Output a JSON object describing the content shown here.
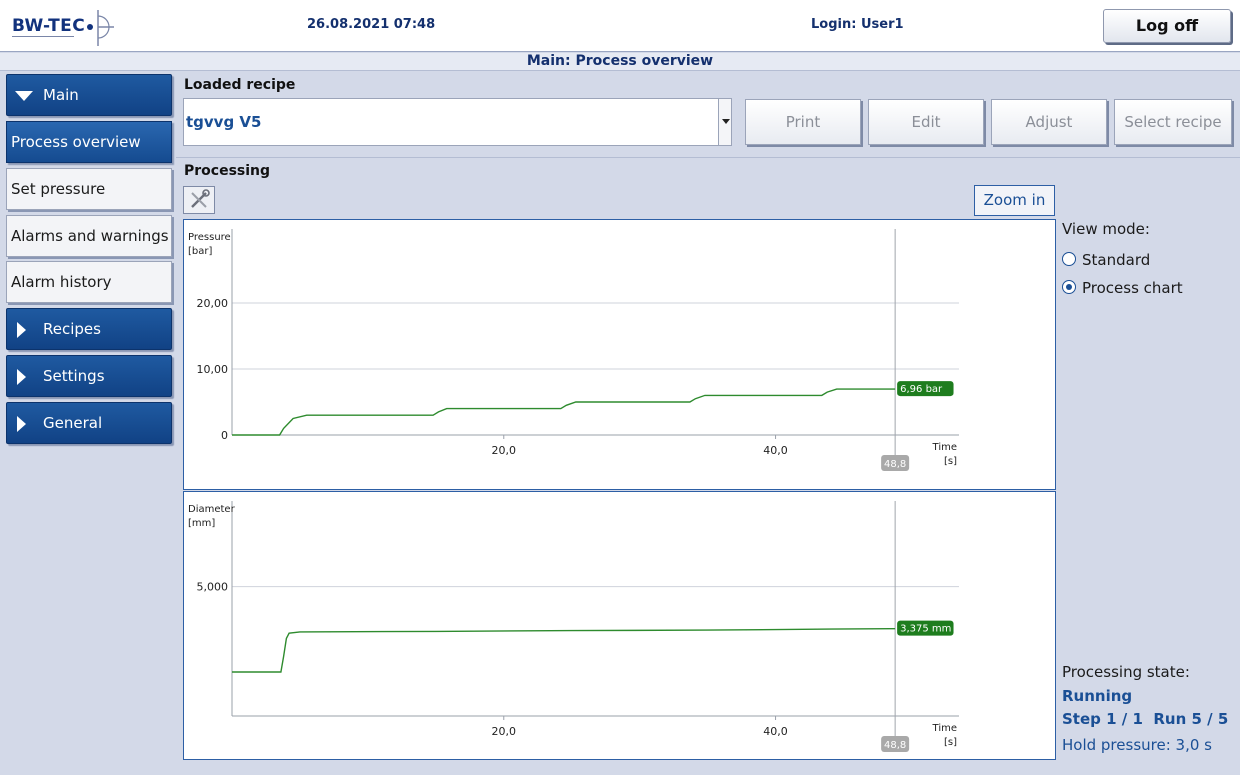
{
  "header": {
    "logo_text": "BW-TEC",
    "datetime": "26.08.2021 07:48",
    "login": "Login: User1",
    "logoff_label": "Log off",
    "page_title": "Main: Process overview"
  },
  "sidebar": {
    "items": [
      {
        "label": "Main",
        "kind": "group-expanded"
      },
      {
        "label": "Process overview",
        "kind": "active"
      },
      {
        "label": "Set pressure",
        "kind": "item"
      },
      {
        "label": "Alarms and warnings",
        "kind": "item"
      },
      {
        "label": "Alarm history",
        "kind": "item"
      },
      {
        "label": "Recipes",
        "kind": "group-collapsed"
      },
      {
        "label": "Settings",
        "kind": "group-collapsed"
      },
      {
        "label": "General",
        "kind": "group-collapsed"
      }
    ]
  },
  "recipe": {
    "section_label": "Loaded recipe",
    "value": "tgvvg V5",
    "buttons": {
      "print": "Print",
      "edit": "Edit",
      "adjust": "Adjust",
      "select": "Select recipe"
    }
  },
  "processing": {
    "section_label": "Processing",
    "zoom_label": "Zoom in",
    "tool_icon": "tools-icon"
  },
  "view_mode": {
    "label": "View mode:",
    "options": [
      "Standard",
      "Process chart"
    ],
    "selected": "Process chart"
  },
  "state": {
    "label": "Processing state:",
    "status": "Running",
    "step_run": "Step 1 / 1  Run 5 / 5",
    "hold": "Hold pressure: 3,0 s"
  },
  "colors": {
    "accent": "#1a4f95",
    "series": "#2e8b2e",
    "marker_badge": "#a9a9a9"
  },
  "chart_data": [
    {
      "type": "line",
      "ylabel": "Pressure",
      "yunit": "[bar]",
      "xlabel": "Time",
      "xunit": "[s]",
      "xlim": [
        0,
        53.5
      ],
      "ylim": [
        0,
        30
      ],
      "x_ticks": [
        "20,0",
        "40,0"
      ],
      "x_tick_values": [
        20,
        40
      ],
      "y_ticks": [
        "0",
        "10,00",
        "20,00"
      ],
      "y_tick_values": [
        0,
        10,
        20
      ],
      "cursor_x": 48.8,
      "cursor_label": "48,8",
      "value_label": "6,96 bar",
      "series": [
        {
          "x": [
            0,
            3.5,
            3.8,
            4.5,
            5.5,
            14.8,
            15.2,
            15.8,
            24.2,
            24.6,
            25.3,
            33.7,
            34.1,
            34.8,
            43.4,
            43.8,
            44.5,
            48.8
          ],
          "y": [
            0,
            0,
            1,
            2.5,
            3,
            3,
            3.5,
            4,
            4,
            4.5,
            5,
            5,
            5.5,
            6,
            6,
            6.5,
            6.96,
            6.96
          ]
        }
      ]
    },
    {
      "type": "line",
      "ylabel": "Diameter",
      "yunit": "[mm]",
      "xlabel": "Time",
      "xunit": "[s]",
      "xlim": [
        0,
        53.5
      ],
      "ylim": [
        0,
        8
      ],
      "x_ticks": [
        "20,0",
        "40,0"
      ],
      "x_tick_values": [
        20,
        40
      ],
      "y_ticks": [
        "5,000"
      ],
      "y_tick_values": [
        5
      ],
      "cursor_x": 48.8,
      "cursor_label": "48,8",
      "value_label": "3,375 mm",
      "series": [
        {
          "x": [
            0,
            3.6,
            3.8,
            4.0,
            4.2,
            5.0,
            15.0,
            25.0,
            35.0,
            44.0,
            48.8
          ],
          "y": [
            1.7,
            1.7,
            2.3,
            3.0,
            3.2,
            3.25,
            3.27,
            3.3,
            3.32,
            3.36,
            3.375
          ]
        }
      ]
    }
  ]
}
